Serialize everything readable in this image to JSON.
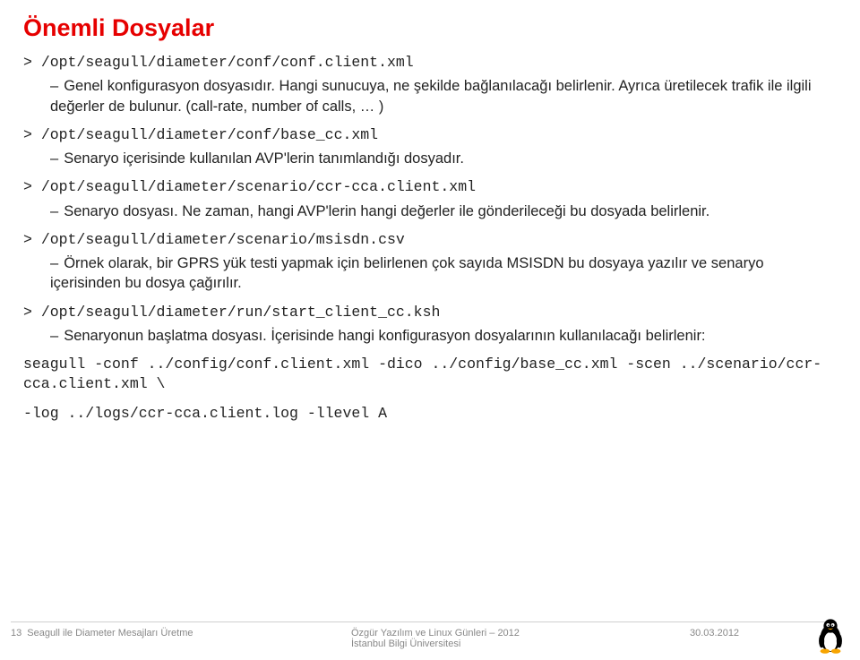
{
  "title": "Önemli Dosyalar",
  "items": [
    {
      "path": "/opt/seagull/diameter/conf/conf.client.xml",
      "desc": "Genel konfigurasyon dosyasıdır. Hangi sunucuya, ne şekilde bağlanılacağı belirlenir. Ayrıca üretilecek trafik ile ilgili değerler de bulunur. (call-rate, number of calls, … )"
    },
    {
      "path": "/opt/seagull/diameter/conf/base_cc.xml",
      "desc": "Senaryo içerisinde kullanılan AVP'lerin tanımlandığı dosyadır."
    },
    {
      "path": "/opt/seagull/diameter/scenario/ccr-cca.client.xml",
      "desc": "Senaryo dosyası. Ne zaman, hangi AVP'lerin hangi değerler ile gönderileceği bu dosyada belirlenir."
    },
    {
      "path": "/opt/seagull/diameter/scenario/msisdn.csv",
      "desc": "Örnek olarak, bir GPRS yük testi yapmak için belirlenen çok sayıda MSISDN bu dosyaya yazılır ve senaryo içerisinden bu dosya çağırılır."
    },
    {
      "path": "/opt/seagull/diameter/run/start_client_cc.ksh",
      "desc": "Senaryonun başlatma dosyası. İçerisinde hangi konfigurasyon dosyalarının kullanılacağı belirlenir:"
    }
  ],
  "command_line1": "seagull -conf ../config/conf.client.xml -dico ../config/base_cc.xml -scen ../scenario/ccr-cca.client.xml \\",
  "command_line2": "-log ../logs/ccr-cca.client.log -llevel A",
  "footer": {
    "pageno": "13",
    "left_title": "Seagull ile Diameter Mesajları Üretme",
    "center_line1": "Özgür Yazılım ve Linux Günleri – 2012",
    "center_line2": "İstanbul Bilgi Üniversitesi",
    "date": "30.03.2012"
  }
}
